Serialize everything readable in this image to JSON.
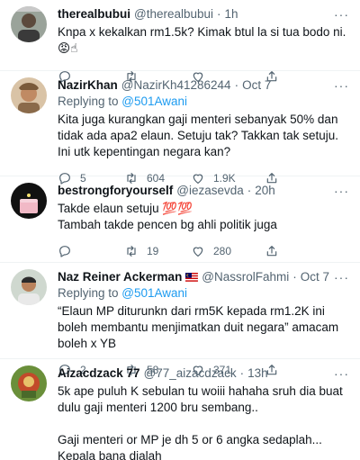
{
  "tweets": [
    {
      "name": "therealbubui",
      "handle": "@therealbubui",
      "dot": "·",
      "time": "1h",
      "replying_label": "",
      "replying_to": "",
      "text": "Knpa x kekalkan rm1.5k? Kimak btul la si tua bodo ni. 😡☝",
      "counts": {
        "reply": "",
        "retweet": "",
        "like": ""
      }
    },
    {
      "name": "NazirKhan",
      "handle": "@NazirKh41286244",
      "dot": "·",
      "time": "Oct 7",
      "replying_label": "Replying to ",
      "replying_to": "@501Awani",
      "text": "Kita juga kurangkan gaji menteri sebanyak 50% dan tidak ada apa2 elaun. Setuju tak? Takkan tak setuju. Ini utk kepentingan negara kan?",
      "counts": {
        "reply": "5",
        "retweet": "604",
        "like": "1.9K"
      }
    },
    {
      "name": "bestrongforyourself",
      "handle": "@iezasevda",
      "dot": "·",
      "time": "20h",
      "replying_label": "",
      "replying_to": "",
      "text": "Takde elaun setuju 💯💯\nTambah takde pencen bg ahli politik juga",
      "counts": {
        "reply": "",
        "retweet": "19",
        "like": "280"
      }
    },
    {
      "name": "Naz Reiner Ackerman",
      "handle": "@NassrolFahmi",
      "dot": "·",
      "time": "Oct 7",
      "replying_label": "Replying to ",
      "replying_to": "@501Awani",
      "text": "“Elaun MP diturunkn dari rm5K kepada rm1.2K ini boleh membantu menjimatkan duit negara” amacam boleh x YB",
      "counts": {
        "reply": "2",
        "retweet": "58",
        "like": "371"
      }
    },
    {
      "name": "Aizacdzack 77",
      "handle": "@77_aizacdzack",
      "dot": "·",
      "time": "13h",
      "replying_label": "",
      "replying_to": "",
      "text": "5k ape puluh K sebulan tu woiii hahaha sruh dia buat dulu gaji menteri 1200 bru sembang..\n\nGaji menteri or MP je dh 5 or 6 angka sedaplah... Kepala bana dialah",
      "counts": {
        "reply": "",
        "retweet": "",
        "like": ""
      }
    }
  ],
  "more_label": "···",
  "icons": [
    "reply-icon",
    "retweet-icon",
    "like-icon",
    "share-icon",
    "more-icon",
    "malaysia-flag-icon"
  ],
  "colors": {
    "link": "#1d9bf0",
    "muted": "#536471",
    "text": "#0f1419",
    "divider": "#eff3f4"
  }
}
